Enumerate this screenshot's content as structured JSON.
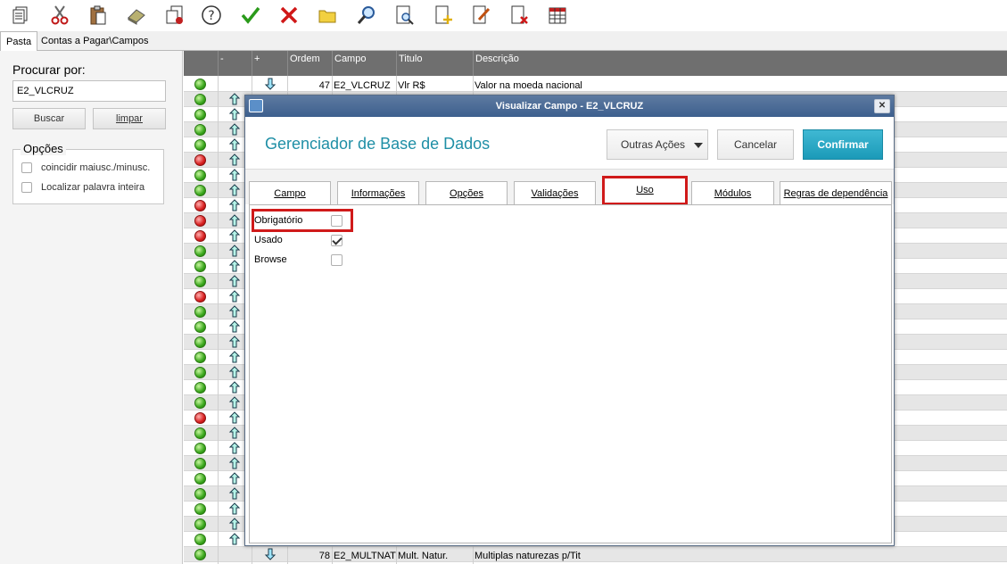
{
  "toolbar": {
    "icons": [
      "copy-icon",
      "cut-icon",
      "paste-icon",
      "eraser-icon",
      "multi-copy-icon",
      "help-icon",
      "confirm-icon",
      "cancel-icon",
      "folder-icon",
      "search-icon",
      "preview-icon",
      "new-doc-icon",
      "edit-doc-icon",
      "delete-doc-icon",
      "table-icon"
    ]
  },
  "tabs": [
    {
      "label": "Pasta",
      "active": true
    },
    {
      "label": "Contas a Pagar\\Campos",
      "active": false
    }
  ],
  "search": {
    "title": "Procurar por:",
    "value": "E2_VLCRUZ",
    "buscar": "Buscar",
    "limpar": "limpar",
    "options_title": "Opções",
    "option1": "coincidir maiusc./minusc.",
    "option2": "Localizar palavra inteira"
  },
  "grid": {
    "headers": [
      "-",
      "+",
      "Ordem",
      "Campo",
      "Titulo",
      "Descrição"
    ],
    "first_row": {
      "ordem": "47",
      "campo": "E2_VLCRUZ",
      "titulo": "Vlr R$",
      "descricao": "Valor na moeda nacional"
    },
    "last_row": {
      "ordem": "78",
      "campo": "E2_MULTNAT",
      "titulo": "Mult. Natur.",
      "descricao": "Multiplas naturezas p/Tit"
    },
    "status": [
      "green",
      "green",
      "green",
      "green",
      "green",
      "red",
      "green",
      "green",
      "red",
      "red",
      "red",
      "green",
      "green",
      "green",
      "red",
      "green",
      "green",
      "green",
      "green",
      "green",
      "green",
      "green",
      "red",
      "green",
      "green",
      "green",
      "green",
      "green",
      "green",
      "green",
      "green",
      "green"
    ]
  },
  "dialog": {
    "title": "Visualizar Campo - E2_VLCRUZ",
    "heading": "Gerenciador de Base de Dados",
    "outras_acoes": "Outras Ações",
    "cancelar": "Cancelar",
    "confirmar": "Confirmar",
    "tabs": [
      "Campo",
      "Informações",
      "Opções",
      "Validações",
      "Uso",
      "Módulos",
      "Regras de dependência"
    ],
    "fields": [
      {
        "label": "Obrigatório",
        "checked": false
      },
      {
        "label": "Usado",
        "checked": true
      },
      {
        "label": "Browse",
        "checked": false
      }
    ]
  },
  "colors": {
    "accent": "#1f8fa6",
    "confirm": "#22a0bd",
    "highlight": "#d01a1a",
    "title_bar": "#4a6a96",
    "grid_header": "#6f6f6f"
  }
}
